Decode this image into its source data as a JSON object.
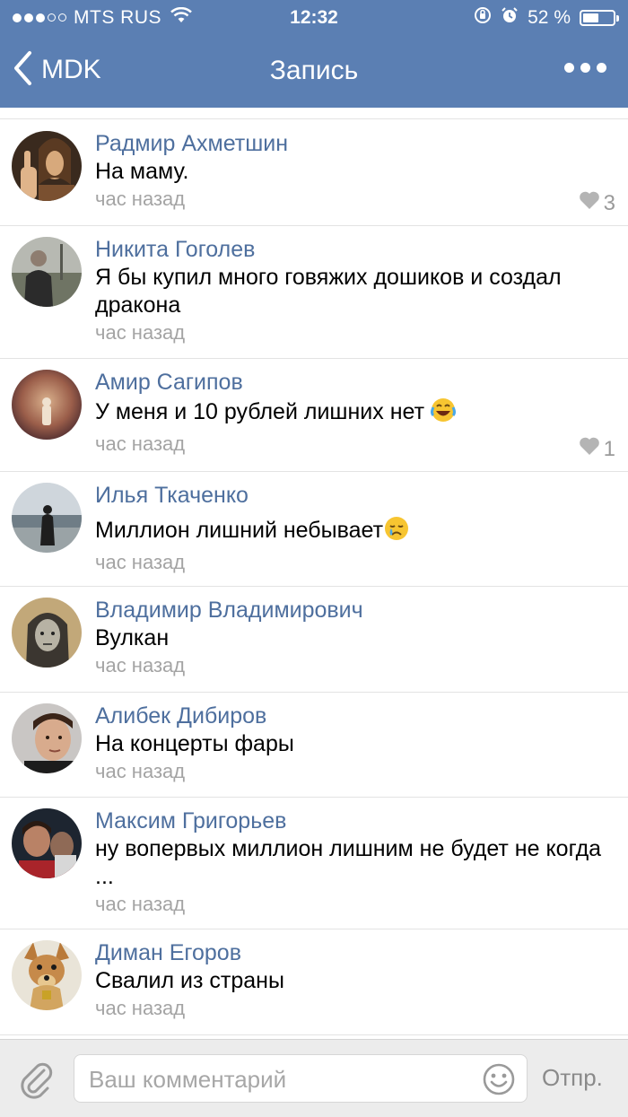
{
  "status_bar": {
    "carrier": "MTS RUS",
    "time": "12:32",
    "battery_text": "52 %",
    "battery_level": 0.52,
    "signal_bars_filled": 3,
    "signal_bars_total": 5
  },
  "nav": {
    "back_label": "MDK",
    "title": "Запись"
  },
  "comments": [
    {
      "name": "Радмир Ахметшин",
      "text": "На маму.",
      "time": "час назад",
      "likes": "3"
    },
    {
      "name": "Никита Гоголев",
      "text": "Я бы купил много говяжих дошиков и создал дракона",
      "time": "час назад",
      "likes": ""
    },
    {
      "name": "Амир Сагипов",
      "text": "У меня и 10 рублей лишних нет",
      "time": "час назад",
      "likes": "1"
    },
    {
      "name": "Илья Ткаченко",
      "text": "Миллион лишний небывает",
      "time": "час назад",
      "likes": ""
    },
    {
      "name": "Владимир Владимирович",
      "text": "Вулкан",
      "time": "час назад",
      "likes": ""
    },
    {
      "name": "Алибек Дибиров",
      "text": "На концерты фары",
      "time": "час назад",
      "likes": ""
    },
    {
      "name": "Максим Григорьев",
      "text": "ну вопервых миллион лишним не будет не когда ...",
      "time": "час назад",
      "likes": ""
    },
    {
      "name": "Диман Егоров",
      "text": "Свалил из страны",
      "time": "час назад",
      "likes": ""
    }
  ],
  "composer": {
    "placeholder": "Ваш комментарий",
    "send_label": "Отпр."
  },
  "colors": {
    "header": "#5b7fb3",
    "name_link": "#4e6f9e",
    "meta_gray": "#a4a4a4"
  }
}
